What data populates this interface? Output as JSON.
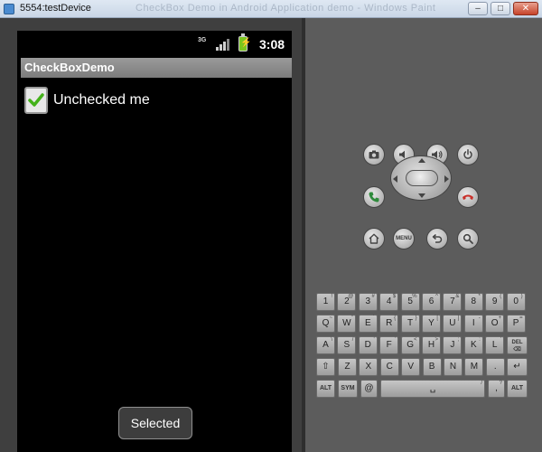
{
  "window": {
    "title": "5554:testDevice",
    "blurred_title": "CheckBox Demo in Android Application demo - Windows Paint"
  },
  "status_bar": {
    "network": "3G",
    "time": "3:08"
  },
  "app": {
    "title": "CheckBoxDemo",
    "checkbox": {
      "label": "Unchecked me",
      "checked": true
    },
    "toast": "Selected"
  },
  "hardware": {
    "menu_label": "MENU"
  },
  "keyboard": {
    "rows": [
      [
        {
          "k": "1",
          "s": "!"
        },
        {
          "k": "2",
          "s": "@"
        },
        {
          "k": "3",
          "s": "#"
        },
        {
          "k": "4",
          "s": "$"
        },
        {
          "k": "5",
          "s": "%"
        },
        {
          "k": "6",
          "s": "^"
        },
        {
          "k": "7",
          "s": "&"
        },
        {
          "k": "8",
          "s": "*"
        },
        {
          "k": "9",
          "s": "("
        },
        {
          "k": "0",
          "s": ")"
        }
      ],
      [
        {
          "k": "Q",
          "s": "~"
        },
        {
          "k": "W",
          "s": "\""
        },
        {
          "k": "E",
          "s": "´"
        },
        {
          "k": "R",
          "s": "{"
        },
        {
          "k": "T",
          "s": "}"
        },
        {
          "k": "Y",
          "s": "["
        },
        {
          "k": "U",
          "s": "]"
        },
        {
          "k": "I",
          "s": "-"
        },
        {
          "k": "O",
          "s": "+"
        },
        {
          "k": "P",
          "s": "="
        }
      ],
      [
        {
          "k": "A",
          "s": "\\"
        },
        {
          "k": "S",
          "s": "/"
        },
        {
          "k": "D",
          "s": "‘"
        },
        {
          "k": "F",
          "s": "’"
        },
        {
          "k": "G",
          "s": "<"
        },
        {
          "k": "H",
          "s": ">"
        },
        {
          "k": "J",
          "s": ";"
        },
        {
          "k": "K",
          "s": ":"
        },
        {
          "k": "L",
          "s": "'"
        }
      ],
      [
        {
          "k": "Z",
          "s": ""
        },
        {
          "k": "X",
          "s": ""
        },
        {
          "k": "C",
          "s": ""
        },
        {
          "k": "V",
          "s": ""
        },
        {
          "k": "B",
          "s": ""
        },
        {
          "k": "N",
          "s": ""
        },
        {
          "k": "M",
          "s": ""
        },
        {
          "k": ".",
          "s": ""
        }
      ]
    ],
    "del_label": "DEL",
    "alt_label": "ALT",
    "sym_label": "SYM",
    "at_label": "@",
    "slash_label": "/",
    "comma_label": ",",
    "question_label": "?"
  },
  "colors": {
    "check_green": "#44b21a",
    "end_call_red": "#c9302a",
    "call_green": "#2f8a3c",
    "battery_green": "#7ac61f"
  }
}
